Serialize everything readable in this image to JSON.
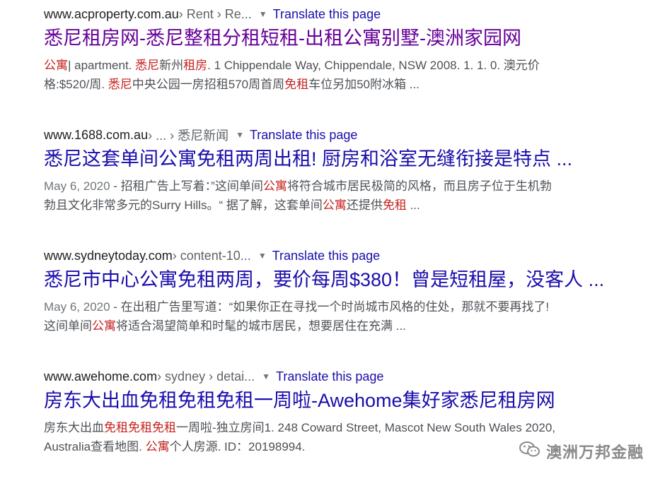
{
  "translate_label": "Translate this page",
  "results": [
    {
      "site": "www.acproperty.com.au",
      "path": " › Rent › Re...",
      "title": "悉尼租房网-悉尼整租分租短租-出租公寓别墅-澳洲家园网",
      "visited": true,
      "snippet_line1": [
        {
          "t": "公寓",
          "hl": true
        },
        {
          "t": "| apartment. ",
          "hl": false
        },
        {
          "t": "悉尼",
          "hl": true
        },
        {
          "t": "新州",
          "hl": false
        },
        {
          "t": "租房",
          "hl": true
        },
        {
          "t": ". 1 Chippendale Way, Chippendale, NSW 2008. 1. 1. 0. 澳元价",
          "hl": false
        }
      ],
      "snippet_line2": [
        {
          "t": "格:$520/周. ",
          "hl": false
        },
        {
          "t": "悉尼",
          "hl": true
        },
        {
          "t": "中央公园一房招租570周首周",
          "hl": false
        },
        {
          "t": "免租",
          "hl": true
        },
        {
          "t": "车位另加50附冰箱 ...",
          "hl": false
        }
      ]
    },
    {
      "site": "www.1688.com.au",
      "path": " › ... › 悉尼新闻",
      "title": "悉尼这套单间公寓免租两周出租! 厨房和浴室无缝衔接是特点 ...",
      "visited": false,
      "date": "May 6, 2020",
      "snippet_line1": [
        {
          "t": " - 招租广告上写着：”这间单间",
          "hl": false
        },
        {
          "t": "公寓",
          "hl": true
        },
        {
          "t": "将符合城市居民极简的风格，而且房子位于生机勃",
          "hl": false
        }
      ],
      "snippet_line2": [
        {
          "t": "勃且文化非常多元的Surry Hills。“ 据了解，这套单间",
          "hl": false
        },
        {
          "t": "公寓",
          "hl": true
        },
        {
          "t": "还提供",
          "hl": false
        },
        {
          "t": "免租",
          "hl": true
        },
        {
          "t": " ...",
          "hl": false
        }
      ]
    },
    {
      "site": "www.sydneytoday.com",
      "path": " › content-10...",
      "title": "悉尼市中心公寓免租两周，要价每周$380！曾是短租屋，没客人 ...",
      "visited": false,
      "date": "May 6, 2020",
      "snippet_line1": [
        {
          "t": " - 在出租广告里写道：“如果你正在寻找一个时尚城市风格的住处，那就不要再找了!",
          "hl": false
        }
      ],
      "snippet_line2": [
        {
          "t": "这间单间",
          "hl": false
        },
        {
          "t": "公寓",
          "hl": true
        },
        {
          "t": "将适合渴望简单和时髦的城市居民，想要居住在充满 ...",
          "hl": false
        }
      ]
    },
    {
      "site": "www.awehome.com",
      "path": " › sydney › detai...",
      "title": "房东大出血免租免租免租一周啦-Awehome集好家悉尼租房网",
      "visited": false,
      "snippet_line1": [
        {
          "t": "房东大出血",
          "hl": false
        },
        {
          "t": "免租免租免租",
          "hl": true
        },
        {
          "t": "一周啦-独立房间1. 248 Coward Street, Mascot New South Wales 2020,",
          "hl": false
        }
      ],
      "snippet_line2": [
        {
          "t": "Australia查看地图. ",
          "hl": false
        },
        {
          "t": "公寓",
          "hl": true
        },
        {
          "t": "个人房源. ID：20198994.",
          "hl": false
        }
      ]
    }
  ],
  "watermark": {
    "icon": "wechat-icon",
    "text": "澳洲万邦金融"
  }
}
